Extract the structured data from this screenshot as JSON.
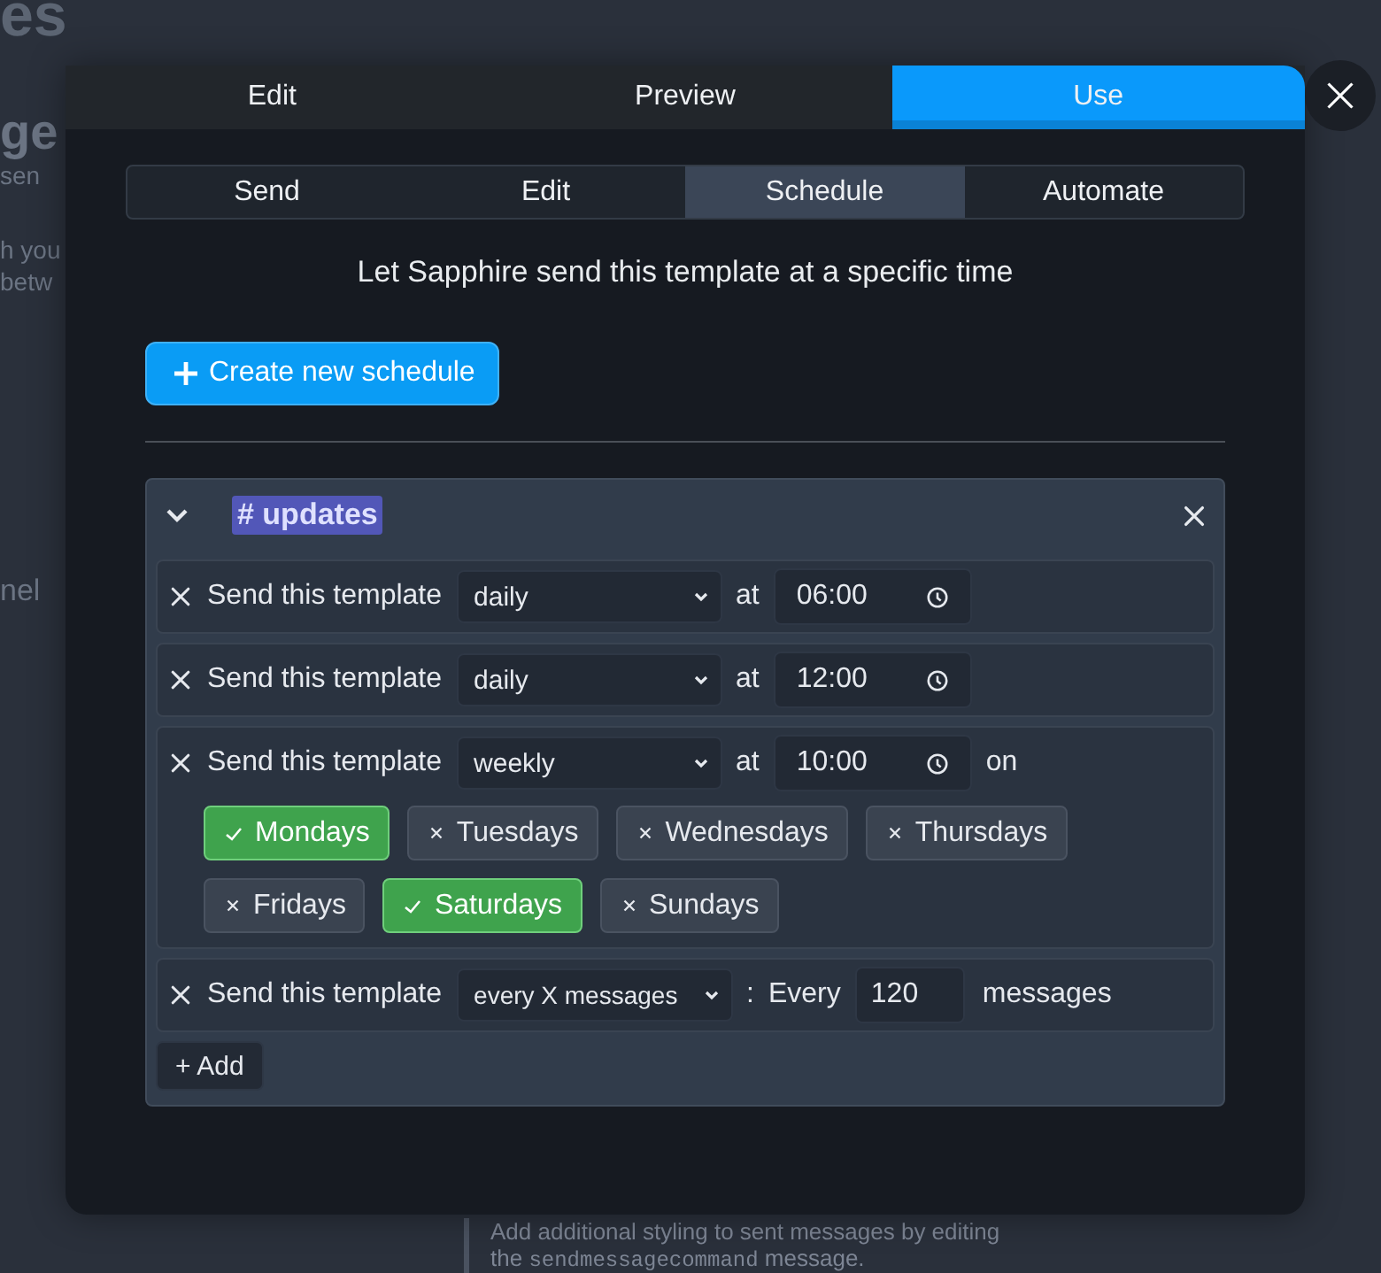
{
  "background_page": {
    "title_fragment": "es",
    "heading_fragment": "ge",
    "text_fragments": [
      "sen",
      "h you",
      "betw"
    ],
    "label_fragment": "nel",
    "note": "Add additional styling to sent messages by editing",
    "note_line_2": {
      "before": "the",
      "code": "sendmessagecommand",
      "after": "message."
    }
  },
  "modal": {
    "tabs": [
      {
        "label": "Edit",
        "selected": false
      },
      {
        "label": "Preview",
        "selected": false
      },
      {
        "label": "Use",
        "selected": true
      }
    ],
    "subtabs": [
      {
        "label": "Send",
        "selected": false
      },
      {
        "label": "Edit",
        "selected": false
      },
      {
        "label": "Schedule",
        "selected": true
      },
      {
        "label": "Automate",
        "selected": false
      }
    ],
    "description": "Let Sapphire send this template at a specific time",
    "create_button": "Create new schedule",
    "schedule": {
      "channel": "# updates",
      "expanded": true,
      "rules": [
        {
          "kind": "time",
          "label": "Send this template",
          "frequency": "daily",
          "at_label": "at",
          "time": "06:00"
        },
        {
          "kind": "time",
          "label": "Send this template",
          "frequency": "daily",
          "at_label": "at",
          "time": "12:00"
        },
        {
          "kind": "weekly",
          "label": "Send this template",
          "frequency": "weekly",
          "at_label": "at",
          "time": "10:00",
          "on_label": "on",
          "days": [
            {
              "label": "Mondays",
              "selected": true
            },
            {
              "label": "Tuesdays",
              "selected": false
            },
            {
              "label": "Wednesdays",
              "selected": false
            },
            {
              "label": "Thursdays",
              "selected": false
            },
            {
              "label": "Fridays",
              "selected": false
            },
            {
              "label": "Saturdays",
              "selected": true
            },
            {
              "label": "Sundays",
              "selected": false
            }
          ]
        },
        {
          "kind": "count",
          "label": "Send this template",
          "frequency": "every X messages",
          "separator": ":",
          "every_label": "Every",
          "count": "120",
          "unit": "messages"
        }
      ],
      "add_button": "+ Add"
    }
  }
}
